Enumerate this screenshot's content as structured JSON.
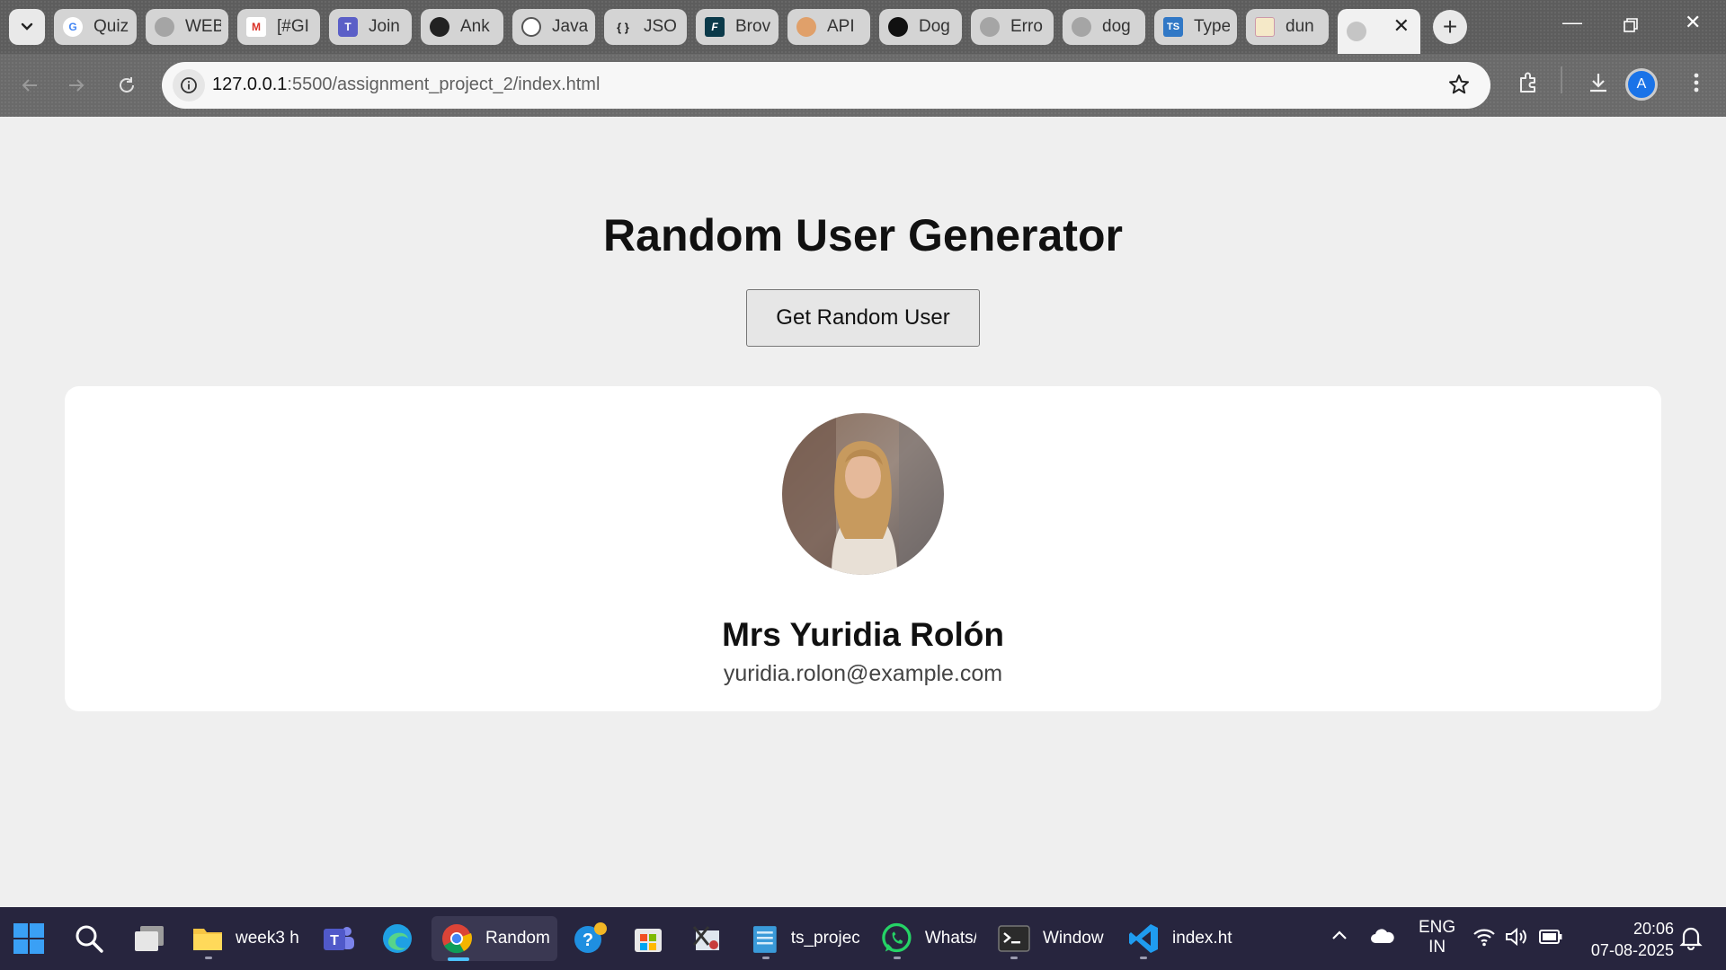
{
  "browser": {
    "tabs": [
      {
        "label": "Quiz",
        "icon": "google-icon"
      },
      {
        "label": "WEB",
        "icon": "globe-icon"
      },
      {
        "label": "[#GI",
        "icon": "gmail-icon"
      },
      {
        "label": "Join",
        "icon": "teams-icon"
      },
      {
        "label": "Ank",
        "icon": "github-icon"
      },
      {
        "label": "Java",
        "icon": "openai-icon"
      },
      {
        "label": "JSO",
        "icon": "json-icon"
      },
      {
        "label": "Brov",
        "icon": "font-icon"
      },
      {
        "label": "API",
        "icon": "dog-api-icon"
      },
      {
        "label": "Dog",
        "icon": "dog-icon"
      },
      {
        "label": "Erro",
        "icon": "globe-icon"
      },
      {
        "label": "dog",
        "icon": "globe-icon"
      },
      {
        "label": "Type",
        "icon": "typescript-icon"
      },
      {
        "label": "dun",
        "icon": "image-icon"
      }
    ],
    "active_tab_icon": "globe-icon",
    "url_host": "127.0.0.1",
    "url_path": ":5500/assignment_project_2/index.html",
    "profile_initial": "A"
  },
  "page": {
    "title": "Random User Generator",
    "button_label": "Get Random User",
    "user": {
      "name": "Mrs Yuridia Rolón",
      "email": "yuridia.rolon@example.com"
    }
  },
  "taskbar": {
    "items": [
      {
        "label": "week3 h"
      },
      {
        "label": "Random"
      },
      {
        "label": "ts_projec"
      },
      {
        "label": "Whats/"
      },
      {
        "label": "Window"
      },
      {
        "label": "index.ht"
      }
    ],
    "lang": "ENG",
    "region": "IN",
    "time": "20:06",
    "date": "07-08-2025"
  }
}
